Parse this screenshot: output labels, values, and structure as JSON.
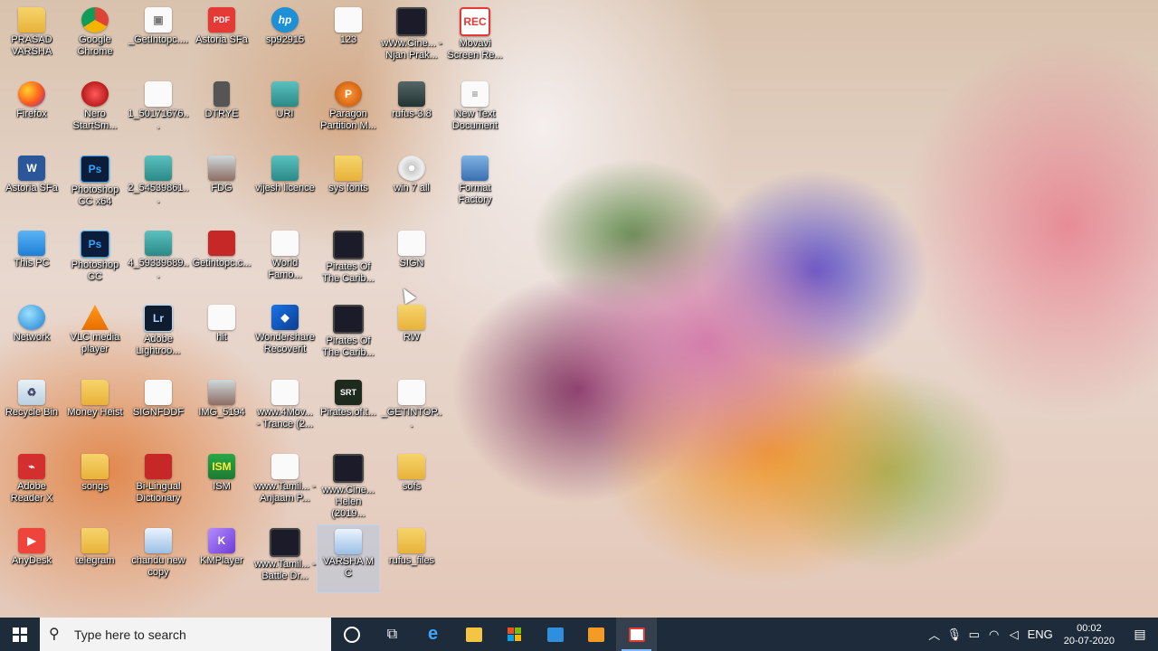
{
  "desktop_icons": [
    {
      "label": "PRASAD VARSHA",
      "icon": "folder-user-icon",
      "glyph": ""
    },
    {
      "label": "Google Chrome",
      "icon": "chrome-icon",
      "glyph": ""
    },
    {
      "label": "_GetIntopc....",
      "icon": "installer-icon",
      "glyph": "▣"
    },
    {
      "label": "Astoria SFa",
      "icon": "pdf-icon",
      "glyph": "PDF"
    },
    {
      "label": "sp92915",
      "icon": "hp-icon",
      "glyph": "hp"
    },
    {
      "label": "123",
      "icon": "file-icon",
      "glyph": ""
    },
    {
      "label": "wWw.Cine... - Njan Prak...",
      "icon": "video-file-icon",
      "glyph": ""
    },
    {
      "label": "Movavi Screen Re...",
      "icon": "movavi-icon",
      "glyph": "REC"
    },
    {
      "label": "Firefox",
      "icon": "firefox-icon",
      "glyph": ""
    },
    {
      "label": "Nero StartSm...",
      "icon": "nero-icon",
      "glyph": ""
    },
    {
      "label": "1_50171676...",
      "icon": "file-icon",
      "glyph": ""
    },
    {
      "label": "DTRYE",
      "icon": "phone-icon",
      "glyph": ""
    },
    {
      "label": "URI",
      "icon": "ticket-icon",
      "glyph": ""
    },
    {
      "label": "Paragon Partition M...",
      "icon": "paragon-icon",
      "glyph": "P"
    },
    {
      "label": "rufus-3.8",
      "icon": "usb-icon",
      "glyph": ""
    },
    {
      "label": "New Text Document",
      "icon": "text-document-icon",
      "glyph": "≡"
    },
    {
      "label": "Astoria SFa",
      "icon": "word-icon",
      "glyph": "W"
    },
    {
      "label": "Photoshop CC x64",
      "icon": "photoshop-icon",
      "glyph": "Ps"
    },
    {
      "label": "2_54539861...",
      "icon": "ticket-icon",
      "glyph": ""
    },
    {
      "label": "FDG",
      "icon": "photo-icon",
      "glyph": ""
    },
    {
      "label": "vijesh licence",
      "icon": "card-icon",
      "glyph": ""
    },
    {
      "label": "sys fonts",
      "icon": "folder-icon",
      "glyph": ""
    },
    {
      "label": "win 7 all",
      "icon": "disc-icon",
      "glyph": ""
    },
    {
      "label": "Format Factory",
      "icon": "format-factory-icon",
      "glyph": ""
    },
    {
      "label": "This PC",
      "icon": "this-pc-icon",
      "glyph": ""
    },
    {
      "label": "Photoshop CC",
      "icon": "photoshop-icon",
      "glyph": "Ps"
    },
    {
      "label": "4_59339689...",
      "icon": "ticket-icon",
      "glyph": ""
    },
    {
      "label": "Getintopc.c...",
      "icon": "winrar-icon",
      "glyph": ""
    },
    {
      "label": "World Famo...",
      "icon": "file-icon",
      "glyph": ""
    },
    {
      "label": "Pirates Of The Carib...",
      "icon": "video-file-icon",
      "glyph": ""
    },
    {
      "label": "SIGN",
      "icon": "file-icon",
      "glyph": ""
    },
    {
      "label": "",
      "icon": "none",
      "glyph": ""
    },
    {
      "label": "Network",
      "icon": "network-icon",
      "glyph": ""
    },
    {
      "label": "VLC media player",
      "icon": "vlc-icon",
      "glyph": ""
    },
    {
      "label": "Adobe Lightroo...",
      "icon": "lightroom-icon",
      "glyph": "Lr"
    },
    {
      "label": "hit",
      "icon": "file-icon",
      "glyph": ""
    },
    {
      "label": "Wondershare Recoverit",
      "icon": "wondershare-icon",
      "glyph": "◆"
    },
    {
      "label": "Pirates Of The Carib...",
      "icon": "video-file-icon",
      "glyph": ""
    },
    {
      "label": "RW",
      "icon": "folder-icon",
      "glyph": ""
    },
    {
      "label": "",
      "icon": "none",
      "glyph": ""
    },
    {
      "label": "Recycle Bin",
      "icon": "recycle-bin-icon",
      "glyph": "♻"
    },
    {
      "label": "Money Heist",
      "icon": "folder-icon",
      "glyph": ""
    },
    {
      "label": "SIGNFDDF",
      "icon": "file-icon",
      "glyph": ""
    },
    {
      "label": "IMG_5194",
      "icon": "photo-icon",
      "glyph": ""
    },
    {
      "label": "www.4Mov... - Trance (2...",
      "icon": "file-icon",
      "glyph": ""
    },
    {
      "label": "Pirates.of.t...",
      "icon": "subtitle-icon",
      "glyph": "SRT"
    },
    {
      "label": "_GETINTOP...",
      "icon": "installer-icon",
      "glyph": ""
    },
    {
      "label": "",
      "icon": "none",
      "glyph": ""
    },
    {
      "label": "Adobe Reader X",
      "icon": "acrobat-icon",
      "glyph": "⌁"
    },
    {
      "label": "songs",
      "icon": "folder-icon",
      "glyph": ""
    },
    {
      "label": "Bi-Lingual Dictionary",
      "icon": "dictionary-icon",
      "glyph": ""
    },
    {
      "label": "ISM",
      "icon": "ism-icon",
      "glyph": "ISM"
    },
    {
      "label": "www.Tamil... - Anjaam P...",
      "icon": "file-icon",
      "glyph": ""
    },
    {
      "label": "www.Cine... Helen (2019...",
      "icon": "video-file-icon",
      "glyph": ""
    },
    {
      "label": "sofs",
      "icon": "folder-icon",
      "glyph": ""
    },
    {
      "label": "",
      "icon": "none",
      "glyph": ""
    },
    {
      "label": "AnyDesk",
      "icon": "anydesk-icon",
      "glyph": "▶"
    },
    {
      "label": "telegram",
      "icon": "folder-icon",
      "glyph": ""
    },
    {
      "label": "chandu new copy",
      "icon": "person-photo-icon",
      "glyph": ""
    },
    {
      "label": "KMPlayer",
      "icon": "kmplayer-icon",
      "glyph": "K"
    },
    {
      "label": "www.Tamil... - Battle Dr...",
      "icon": "video-file-icon",
      "glyph": ""
    },
    {
      "label": "VARSHA M C",
      "icon": "person-photo-icon",
      "glyph": ""
    },
    {
      "label": "rufus_files",
      "icon": "folder-icon",
      "glyph": ""
    },
    {
      "label": "",
      "icon": "none",
      "glyph": ""
    }
  ],
  "taskbar": {
    "search_placeholder": "Type here to search",
    "language": "ENG",
    "time": "00:02",
    "date": "20-07-2020"
  },
  "colors": {
    "taskbar_bg": "#1d2b3a",
    "accent": "#7fb7ff"
  }
}
